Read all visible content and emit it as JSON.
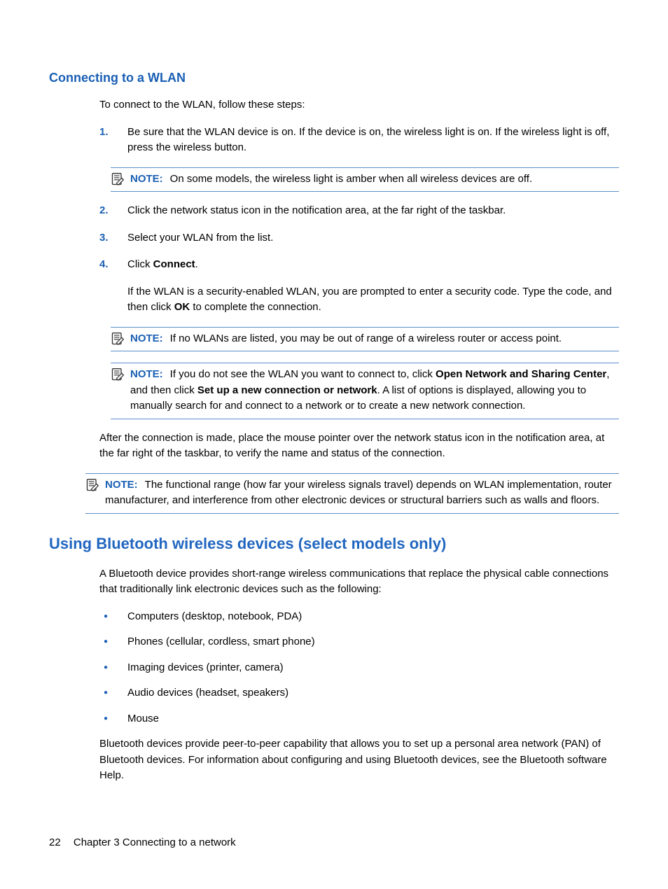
{
  "section1": {
    "heading": "Connecting to a WLAN",
    "intro": "To connect to the WLAN, follow these steps:",
    "steps": {
      "s1": {
        "num": "1.",
        "text": "Be sure that the WLAN device is on. If the device is on, the wireless light is on. If the wireless light is off, press the wireless button."
      },
      "s2": {
        "num": "2.",
        "text": "Click the network status icon in the notification area, at the far right of the taskbar."
      },
      "s3": {
        "num": "3.",
        "text": "Select your WLAN from the list."
      },
      "s4": {
        "num": "4.",
        "pre": "Click ",
        "bold": "Connect",
        "post": ".",
        "para_a": "If the WLAN is a security-enabled WLAN, you are prompted to enter a security code. Type the code, and then click ",
        "para_bold": "OK",
        "para_b": " to complete the connection."
      }
    },
    "note_label": "NOTE:",
    "note1": "On some models, the wireless light is amber when all wireless devices are off.",
    "note2": "If no WLANs are listed, you may be out of range of a wireless router or access point.",
    "note3": {
      "a": "If you do not see the WLAN you want to connect to, click ",
      "b1": "Open Network and Sharing Center",
      "c": ", and then click ",
      "b2": "Set up a new connection or network",
      "d": ". A list of options is displayed, allowing you to manually search for and connect to a network or to create a new network connection."
    },
    "after": "After the connection is made, place the mouse pointer over the network status icon in the notification area, at the far right of the taskbar, to verify the name and status of the connection.",
    "note4": "The functional range (how far your wireless signals travel) depends on WLAN implementation, router manufacturer, and interference from other electronic devices or structural barriers such as walls and floors."
  },
  "section2": {
    "heading": "Using Bluetooth wireless devices (select models only)",
    "intro": "A Bluetooth device provides short-range wireless communications that replace the physical cable connections that traditionally link electronic devices such as the following:",
    "bullets": {
      "b1": "Computers (desktop, notebook, PDA)",
      "b2": "Phones (cellular, cordless, smart phone)",
      "b3": "Imaging devices (printer, camera)",
      "b4": "Audio devices (headset, speakers)",
      "b5": "Mouse"
    },
    "outro": "Bluetooth devices provide peer-to-peer capability that allows you to set up a personal area network (PAN) of Bluetooth devices. For information about configuring and using Bluetooth devices, see the Bluetooth software Help."
  },
  "footer": {
    "page": "22",
    "chapter": "Chapter 3   Connecting to a network"
  }
}
